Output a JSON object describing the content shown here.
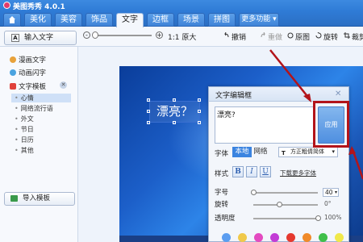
{
  "app": {
    "title": "美图秀秀 4.0.1"
  },
  "tabs": [
    {
      "label": ""
    },
    {
      "label": "美化"
    },
    {
      "label": "美容"
    },
    {
      "label": "饰品"
    },
    {
      "label": "文字"
    },
    {
      "label": "边框"
    },
    {
      "label": "场景"
    },
    {
      "label": "拼图"
    },
    {
      "label": "更多功能 ▾"
    }
  ],
  "toolbar": {
    "input_text_label": "输入文字",
    "ratio": "1:1 原大",
    "undo": "撤销",
    "redo": "重做",
    "original": "原图",
    "rotate": "旋转",
    "crop": "裁剪"
  },
  "sidebar": {
    "items": [
      {
        "label": "漫画文字"
      },
      {
        "label": "动画闪字"
      },
      {
        "label": "文字模板"
      }
    ],
    "template_subitems": [
      "心情",
      "网络流行语",
      "外文",
      "节日",
      "日历",
      "其他"
    ],
    "import_label": "导入模板"
  },
  "canvas": {
    "text": "漂亮？"
  },
  "dialog": {
    "title": "文字编辑框",
    "text_value": "漂亮?",
    "apply_label": "应用",
    "font_label": "字体",
    "font_local": "本地",
    "font_web": "网络",
    "font_value": "方正粗倩简体",
    "style_label": "样式",
    "bold": "B",
    "italic": "I",
    "underline": "U",
    "more_fonts": "下载更多字体",
    "size_label": "字号",
    "size_value": "40",
    "rotate_label": "旋转",
    "rotate_value": "0°",
    "opacity_label": "透明度",
    "opacity_value": "100%",
    "swatches": [
      "#5b9df0",
      "#f0c94a",
      "#e34ac0",
      "#c23cd6",
      "#e5392f",
      "#f08a2a",
      "#3fbf4a",
      "#f0e84a"
    ]
  },
  "colors": {
    "accent": "#2f7bd6",
    "annotation": "#b3141a"
  }
}
